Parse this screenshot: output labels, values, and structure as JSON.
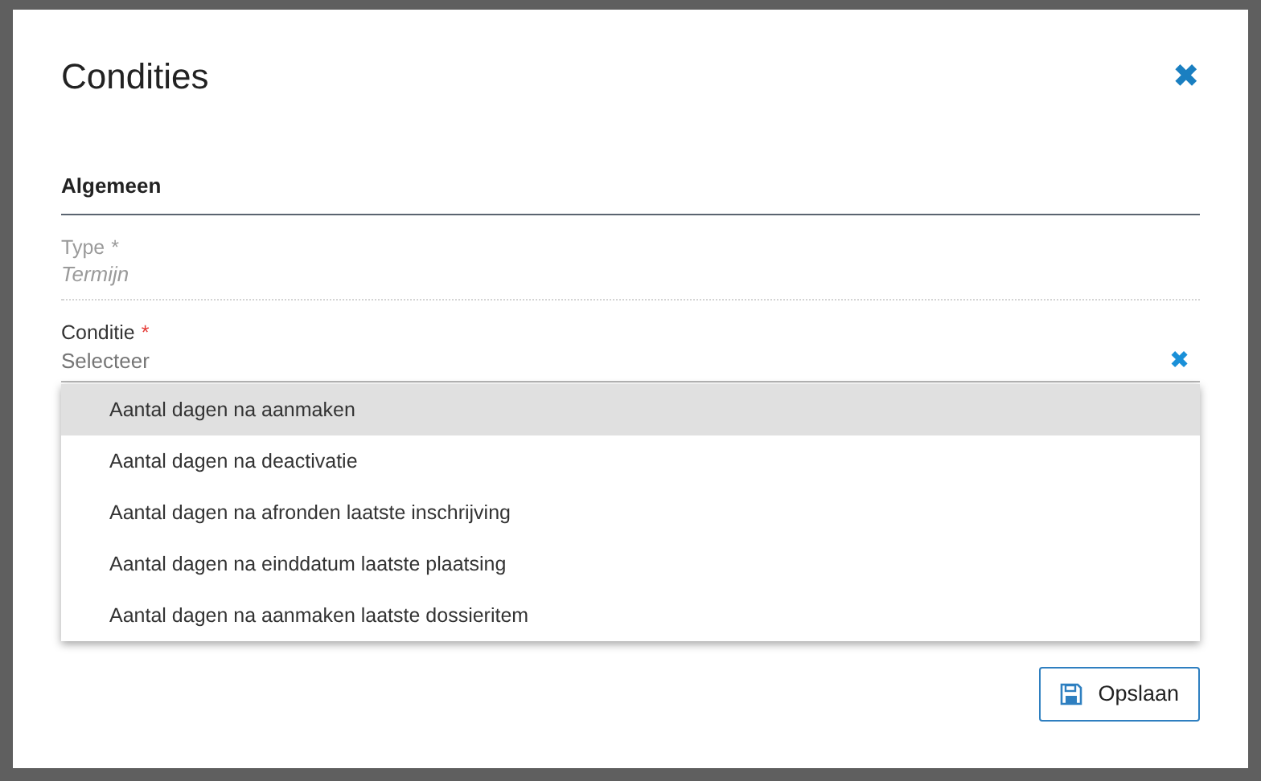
{
  "dialog": {
    "title": "Condities",
    "close": "✖"
  },
  "section": {
    "title": "Algemeen"
  },
  "fields": [
    {
      "label": "Type",
      "required_mark": "*",
      "value": "Termijn",
      "disabled": true
    },
    {
      "label": "Conditie",
      "required_mark": "*",
      "placeholder": "Selecteer",
      "disabled": false,
      "clear": "✖",
      "expanded": true
    }
  ],
  "options": [
    {
      "label": "Aantal dagen na aanmaken",
      "selected": true
    },
    {
      "label": "Aantal dagen na deactivatie",
      "selected": false
    },
    {
      "label": "Aantal dagen na afronden laatste inschrijving",
      "selected": false
    },
    {
      "label": "Aantal dagen na einddatum laatste plaatsing",
      "selected": false
    },
    {
      "label": "Aantal dagen na aanmaken laatste dossieritem",
      "selected": false
    }
  ],
  "buttons": [
    {
      "label": "Opslaan",
      "kind": "save"
    }
  ]
}
